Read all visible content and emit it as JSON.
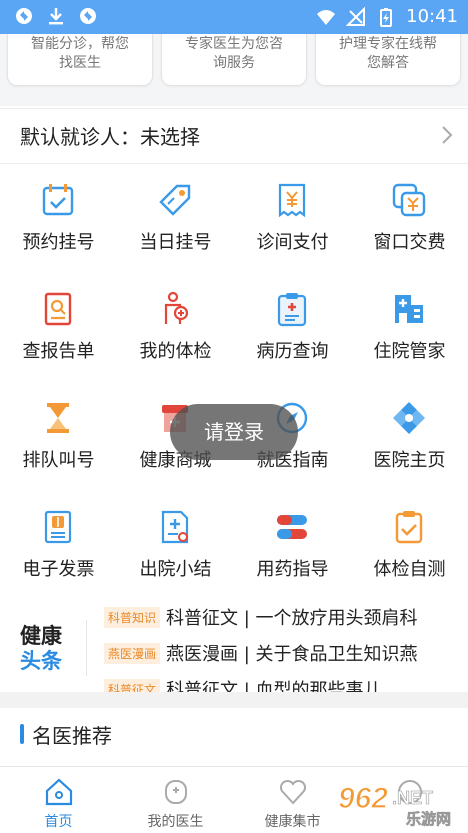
{
  "status_bar": {
    "time": "10:41"
  },
  "service_cards": [
    {
      "line1": "智能分诊，帮您",
      "line2": "找医生"
    },
    {
      "line1": "专家医生为您咨",
      "line2": "询服务"
    },
    {
      "line1": "护理专家在线帮",
      "line2": "您解答"
    }
  ],
  "default_patient": {
    "label": "默认就诊人：未选择"
  },
  "grid": [
    {
      "label": "预约挂号",
      "icon": "calendar-check-icon"
    },
    {
      "label": "当日挂号",
      "icon": "tag-icon"
    },
    {
      "label": "诊间支付",
      "icon": "receipt-yen-icon"
    },
    {
      "label": "窗口交费",
      "icon": "yen-window-icon"
    },
    {
      "label": "查报告单",
      "icon": "report-search-icon"
    },
    {
      "label": "我的体检",
      "icon": "person-checkup-icon"
    },
    {
      "label": "病历查询",
      "icon": "medical-record-icon"
    },
    {
      "label": "住院管家",
      "icon": "hospital-building-icon"
    },
    {
      "label": "排队叫号",
      "icon": "hourglass-icon"
    },
    {
      "label": "健康商城",
      "icon": "shop-bag-icon"
    },
    {
      "label": "就医指南",
      "icon": "compass-icon"
    },
    {
      "label": "医院主页",
      "icon": "hospital-cross-icon"
    },
    {
      "label": "电子发票",
      "icon": "invoice-icon"
    },
    {
      "label": "出院小结",
      "icon": "discharge-summary-icon"
    },
    {
      "label": "用药指导",
      "icon": "pill-icon"
    },
    {
      "label": "体检自测",
      "icon": "clipboard-check-icon"
    }
  ],
  "toast": {
    "text": "请登录"
  },
  "news": {
    "logo_line1": "健康",
    "logo_line2": "头条",
    "items": [
      {
        "tag": "科普知识",
        "text": "科普征文 | 一个放疗用头颈肩科"
      },
      {
        "tag": "燕医漫画",
        "text": "燕医漫画 | 关于食品卫生知识燕"
      },
      {
        "tag": "科普征文",
        "text": "科普征文 | 血型的那些事儿"
      }
    ]
  },
  "section": {
    "title": "名医推荐"
  },
  "tabs": [
    {
      "label": "首页",
      "icon": "home-icon"
    },
    {
      "label": "我的医生",
      "icon": "doctor-icon"
    },
    {
      "label": "健康集市",
      "icon": "heart-icon"
    },
    {
      "label": "",
      "icon": "profile-icon"
    }
  ],
  "watermark": {
    "number": "962",
    "suffix": ".NET",
    "site": "乐游网"
  },
  "colors": {
    "status_bar": "#5aa6f5",
    "accent": "#2a8be0",
    "tag": "#e98a2a",
    "icon_orange": "#f39a36",
    "icon_red": "#e2463b"
  }
}
